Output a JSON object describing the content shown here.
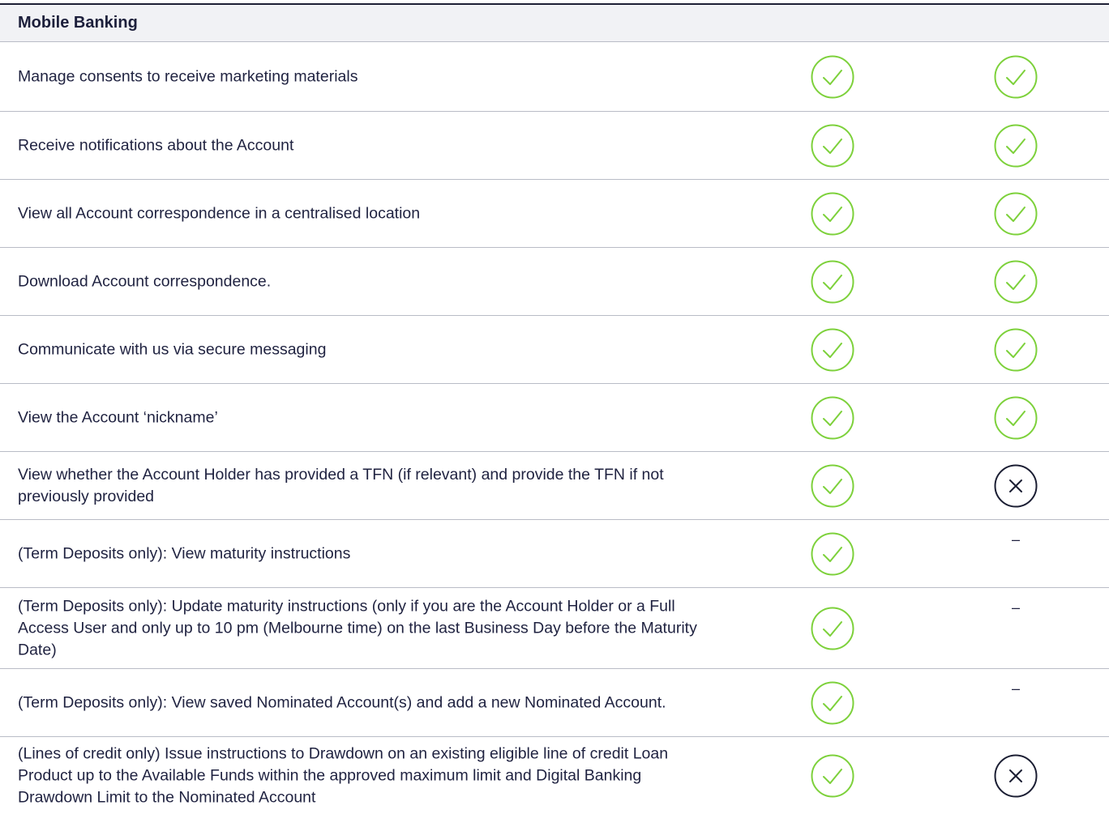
{
  "header": {
    "title": "Mobile Banking"
  },
  "colors": {
    "check": "#7dd13b",
    "cross": "#1b1e33",
    "rule": "#b9bcc6",
    "header_bg": "#f1f2f5"
  },
  "rows": [
    {
      "text": "Manage consents to receive marketing materials",
      "col1": "check",
      "col2": "check"
    },
    {
      "text": "Receive notifications about the Account",
      "col1": "check",
      "col2": "check"
    },
    {
      "text": "View all Account correspondence in a centralised location",
      "col1": "check",
      "col2": "check"
    },
    {
      "text": "Download Account correspondence.",
      "col1": "check",
      "col2": "check"
    },
    {
      "text": "Communicate with us via secure messaging",
      "col1": "check",
      "col2": "check"
    },
    {
      "text": "View the Account ‘nickname’",
      "col1": "check",
      "col2": "check"
    },
    {
      "text": "View whether the Account Holder has provided a TFN (if relevant) and provide the TFN if not previously provided",
      "col1": "check",
      "col2": "cross"
    },
    {
      "text": "(Term Deposits only): View maturity instructions",
      "col1": "check",
      "col2": "dash",
      "col2_text": "–"
    },
    {
      "text": "(Term Deposits only): Update maturity instructions (only if you are the Account Holder or a Full Access User and only up to 10 pm (Melbourne time) on the last Business Day before the Maturity Date)",
      "col1": "check",
      "col2": "dash",
      "col2_text": "–"
    },
    {
      "text": "(Term Deposits only): View saved Nominated Account(s) and add a new Nominated Account.",
      "col1": "check",
      "col2": "dash",
      "col2_text": "–"
    },
    {
      "text": "(Lines of credit only) Issue instructions to Drawdown on an existing eligible line of credit Loan Product up to the Available Funds within the approved maximum limit and Digital Banking Drawdown Limit to the Nominated Account",
      "col1": "check",
      "col2": "cross"
    }
  ]
}
